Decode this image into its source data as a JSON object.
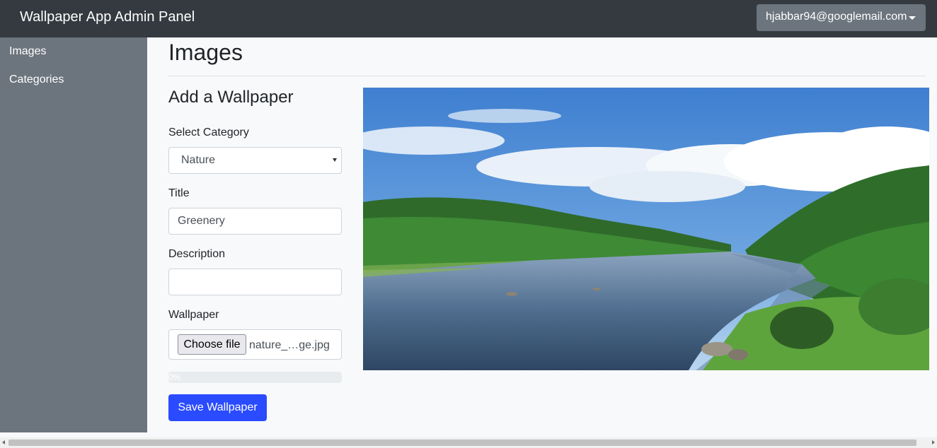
{
  "header": {
    "brand": "Wallpaper App Admin Panel",
    "user_email": "hjabbar94@googlemail.com"
  },
  "sidebar": {
    "items": [
      {
        "label": "Images"
      },
      {
        "label": "Categories"
      }
    ]
  },
  "main": {
    "page_title": "Images",
    "form": {
      "heading": "Add a Wallpaper",
      "category_label": "Select Category",
      "category_value": "Nature",
      "title_label": "Title",
      "title_value": "Greenery",
      "description_label": "Description",
      "description_value": "",
      "wallpaper_label": "Wallpaper",
      "choose_file_label": "Choose file",
      "file_name": "nature_…ge.jpg",
      "progress_text": "0%",
      "progress_value": 0,
      "save_label": "Save Wallpaper"
    },
    "preview": {
      "icon": "landscape-photo-river-forest"
    }
  },
  "colors": {
    "header_bg": "#343a40",
    "sidebar_bg": "#6c757d",
    "primary_button": "#2a4bff"
  }
}
